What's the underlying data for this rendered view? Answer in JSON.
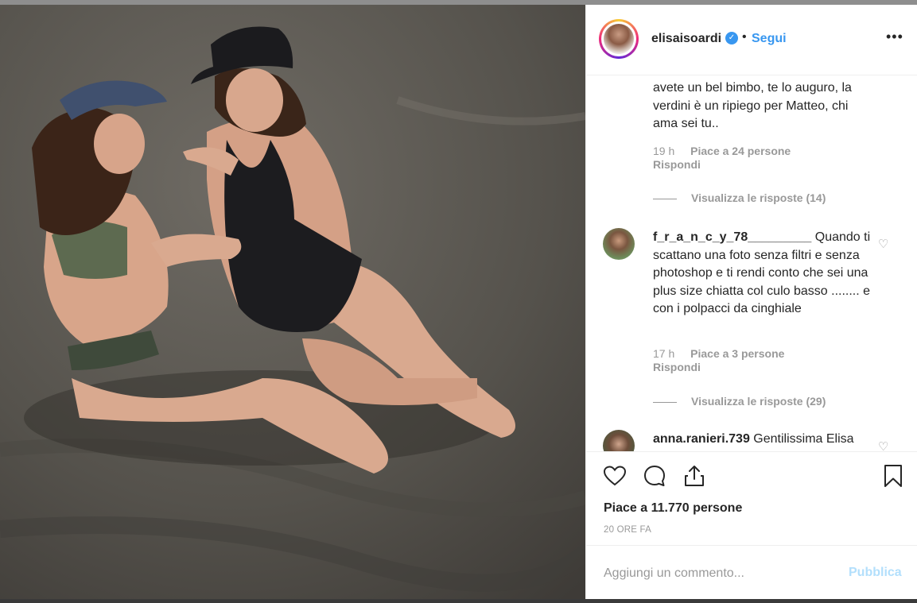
{
  "post": {
    "photo_icon": "beach-photo"
  },
  "header": {
    "username": "elisaisoardi",
    "verified_icon": "verified-badge-icon",
    "separator": "•",
    "follow_label": "Segui",
    "more_label": "•••"
  },
  "comments": [
    {
      "text": "avete un bel bimbo, te lo auguro, la verdini è un ripiego per Matteo, chi ama sei tu..",
      "time": "19 h",
      "likes": "Piace a 24 persone",
      "reply": "Rispondi",
      "view_replies": "Visualizza le risposte (14)"
    },
    {
      "username": "f_r_a_n_c_y_78_________",
      "text": "Quando ti scattano una foto senza filtri e senza photoshop e ti rendi conto che sei una plus size chiatta col culo basso ........ e con i polpacci da cinghiale",
      "time": "17 h",
      "likes": "Piace a 3 persone",
      "reply": "Rispondi",
      "view_replies": "Visualizza le risposte (29)"
    },
    {
      "username": "anna.ranieri.739",
      "text": "Gentilissima Elisa"
    }
  ],
  "actions": {
    "like_icon": "heart-icon",
    "comment_icon": "comment-icon",
    "share_icon": "share-icon",
    "save_icon": "bookmark-icon",
    "likes_count": "Piace a 11.770 persone",
    "time_ago": "20 ORE FA"
  },
  "add_comment": {
    "placeholder": "Aggiungi un commento...",
    "publish_label": "Pubblica"
  },
  "colors": {
    "accent": "#3897f0",
    "publish_disabled": "#b2dffc",
    "meta_text": "#999999",
    "text": "#262626"
  }
}
